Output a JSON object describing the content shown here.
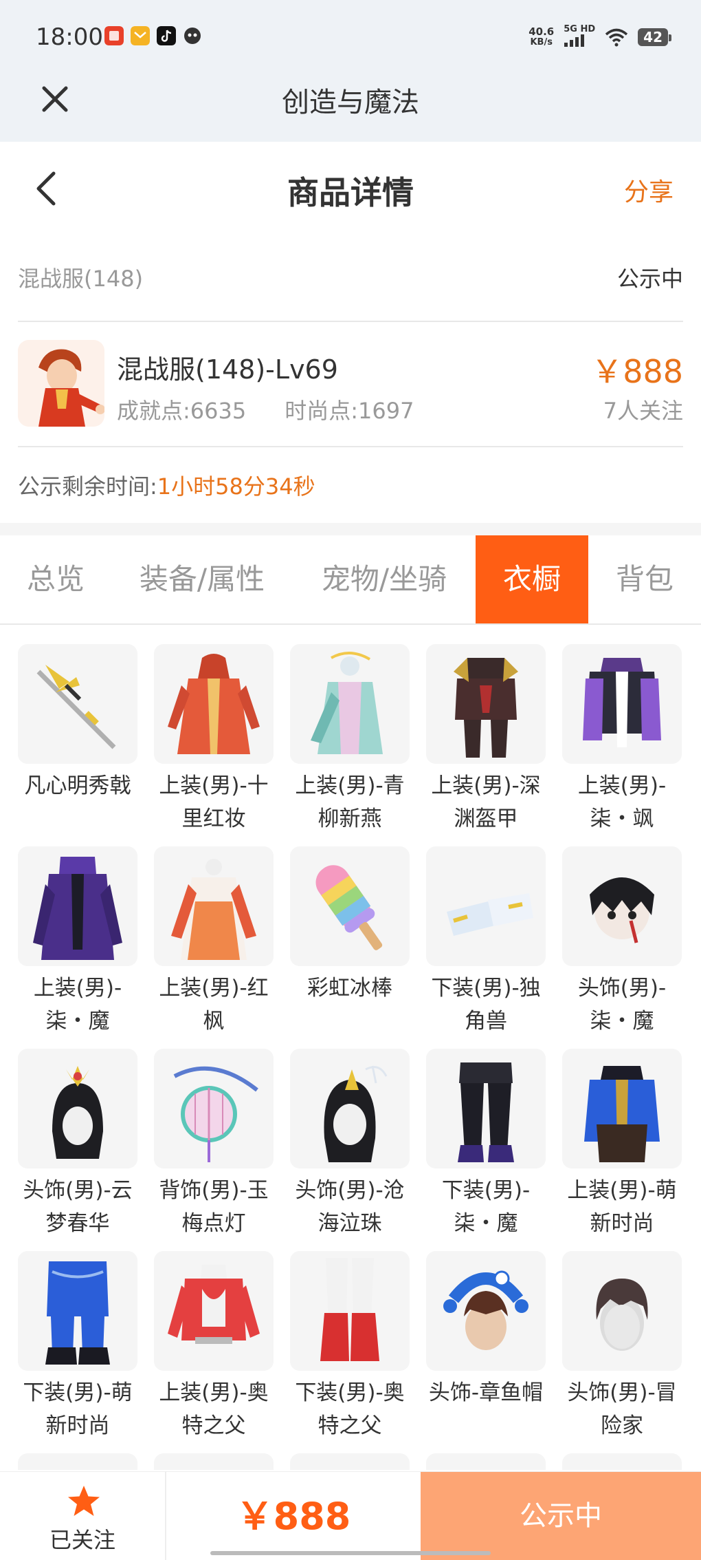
{
  "status_bar": {
    "time": "18:00",
    "speed_value": "40.6",
    "speed_unit": "KB/s",
    "network": "5G HD",
    "battery": "42"
  },
  "mini_program": {
    "title": "创造与魔法"
  },
  "header": {
    "title": "商品详情",
    "share": "分享"
  },
  "server": {
    "name": "混战服(148)",
    "status": "公示中"
  },
  "item": {
    "name": "混战服(148)-Lv69",
    "achievement": "成就点:6635",
    "fashion": "时尚点:1697",
    "price": "￥888",
    "followers": "7人关注"
  },
  "countdown": {
    "label": "公示剩余时间:",
    "value": "1小时58分34秒"
  },
  "tabs": [
    "总览",
    "装备/属性",
    "宠物/坐骑",
    "衣橱",
    "背包"
  ],
  "active_tab_index": 3,
  "wardrobe": [
    {
      "label": "凡心明秀戟",
      "icon": "halberd"
    },
    {
      "label": "上装(男)-十里红妆",
      "icon": "red-robe"
    },
    {
      "label": "上装(男)-青柳新燕",
      "icon": "teal-robe"
    },
    {
      "label": "上装(男)-深渊盔甲",
      "icon": "dark-armor"
    },
    {
      "label": "上装(男)-柒・飒",
      "icon": "purple-jacket"
    },
    {
      "label": "上装(男)-柒・魔",
      "icon": "purple-coat"
    },
    {
      "label": "上装(男)-红枫",
      "icon": "maple-robe"
    },
    {
      "label": "彩虹冰棒",
      "icon": "rainbow-popsicle"
    },
    {
      "label": "下装(男)-独角兽",
      "icon": "unicorn-shoes"
    },
    {
      "label": "头饰(男)-柒・魔",
      "icon": "masked-head"
    },
    {
      "label": "头饰(男)-云梦春华",
      "icon": "ornate-hair"
    },
    {
      "label": "背饰(男)-玉梅点灯",
      "icon": "lantern"
    },
    {
      "label": "头饰(男)-沧海泣珠",
      "icon": "pearl-hair"
    },
    {
      "label": "下装(男)-柒・魔",
      "icon": "dark-pants"
    },
    {
      "label": "上装(男)-萌新时尚",
      "icon": "blue-robe"
    },
    {
      "label": "下装(男)-萌新时尚",
      "icon": "blue-pants"
    },
    {
      "label": "上装(男)-奥特之父",
      "icon": "hero-top"
    },
    {
      "label": "下装(男)-奥特之父",
      "icon": "hero-boots"
    },
    {
      "label": "头饰-章鱼帽",
      "icon": "octopus-hat"
    },
    {
      "label": "头饰(男)-冒险家",
      "icon": "adventurer-hair"
    }
  ],
  "bottom": {
    "follow_label": "已关注",
    "price": "￥888",
    "status": "公示中"
  },
  "colors": {
    "accent": "#e8731a",
    "tab_active": "#ff5e14",
    "status_button": "#fda574"
  }
}
